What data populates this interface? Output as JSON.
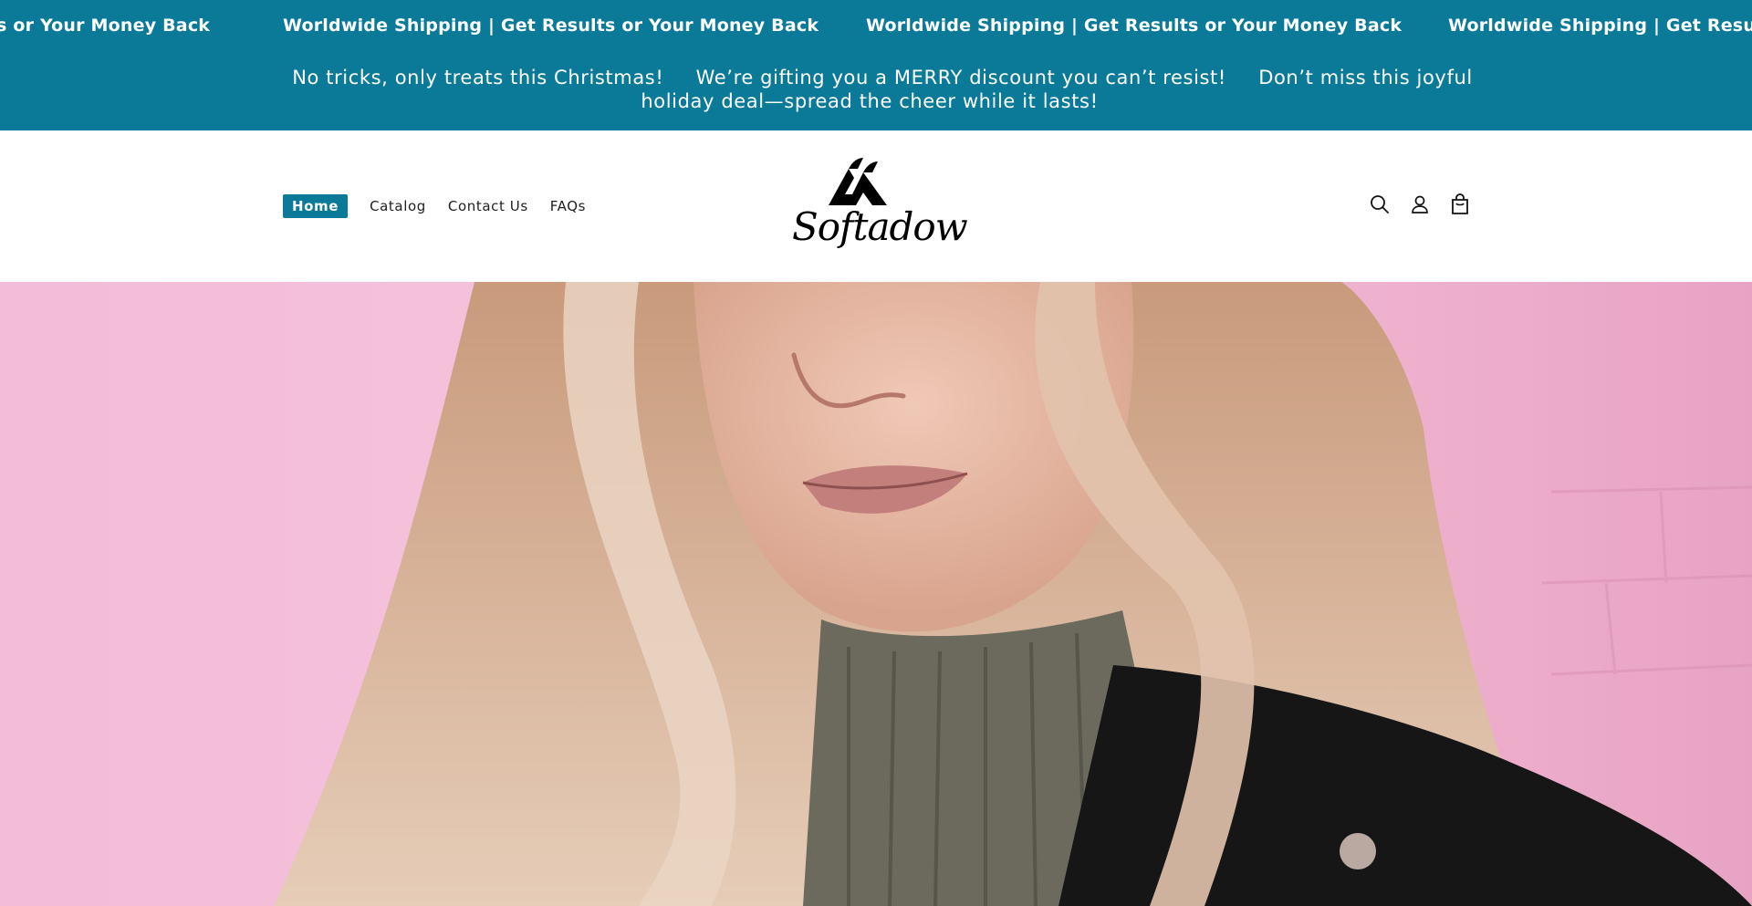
{
  "announcement": {
    "marquee_text": "Worldwide Shipping | Get Results or Your Money Back",
    "marquee_partial_left": "s or Your Money Back",
    "marquee_partial_right": "Worldwide Shipping | Get Results",
    "promo": [
      "No tricks, only treats this Christmas!",
      "We’re gifting you a MERRY discount you can’t resist!",
      "Don’t miss this joyful holiday deal—spread the cheer while it lasts!"
    ],
    "color": "#0b7a99"
  },
  "nav": {
    "items": [
      {
        "label": "Home",
        "active": true
      },
      {
        "label": "Catalog",
        "active": false
      },
      {
        "label": "Contact Us",
        "active": false
      },
      {
        "label": "FAQs",
        "active": false
      }
    ]
  },
  "logo": {
    "wordmark": "Softadow"
  },
  "header_icons": [
    "search-icon",
    "account-icon",
    "cart-icon"
  ],
  "hero": {
    "description_colors": {
      "wall": "#f4b6d6",
      "hair": "#d9b39a",
      "sweater": "#6b6a5c",
      "jacket": "#161616"
    }
  }
}
